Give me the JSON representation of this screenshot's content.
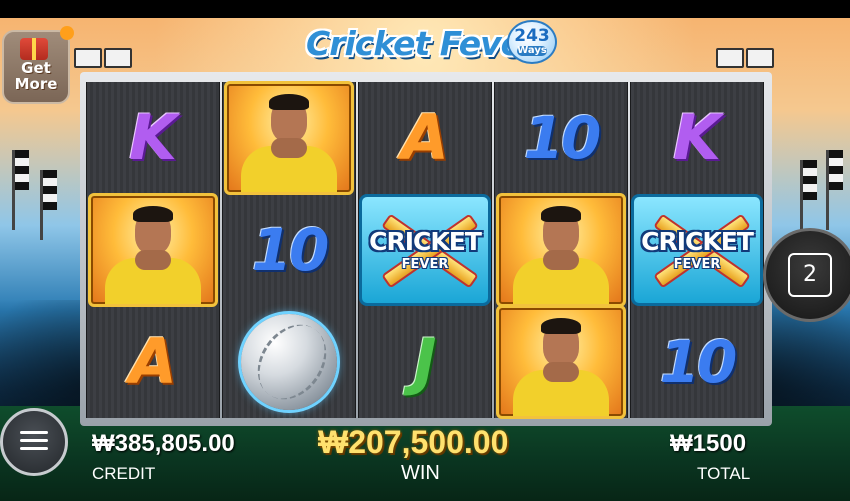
{
  "game": {
    "title": "Cricket Fever",
    "ways_badge": {
      "number": "243",
      "label": "Ways"
    }
  },
  "get_more": {
    "label_line1": "Get",
    "label_line2": "More"
  },
  "reels": [
    [
      "K",
      "player",
      "A"
    ],
    [
      "player",
      "10",
      "ball"
    ],
    [
      "A",
      "wild",
      "J"
    ],
    [
      "10",
      "player",
      "player"
    ],
    [
      "K",
      "wild",
      "10"
    ]
  ],
  "symbols": {
    "wild_line1": "CRICKET",
    "wild_line2": "FEVER"
  },
  "side_button": {
    "value": "2"
  },
  "bottom": {
    "credit_value": "₩385,805.00",
    "credit_label": "CREDIT",
    "win_value": "₩207,500.00",
    "win_label": "WIN",
    "total_value": "₩1500",
    "total_label": "TOTAL"
  },
  "colors": {
    "win_text": "#ffe16e",
    "k_symbol": "#b15df0",
    "a_symbol": "#ff9b2a",
    "ten_symbol": "#3b7cf0",
    "j_symbol": "#4bc34a"
  }
}
